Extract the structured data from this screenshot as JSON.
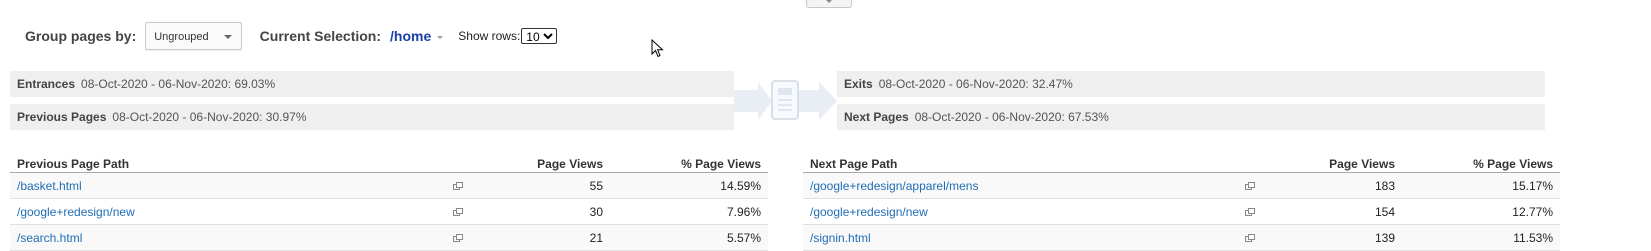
{
  "controls": {
    "group_label": "Group pages by:",
    "group_value": "Ungrouped",
    "current_label": "Current Selection:",
    "current_value": "/home",
    "rows_label": "Show rows:",
    "rows_value": "10"
  },
  "summary": {
    "entrances": {
      "label": "Entrances",
      "text": "08-Oct-2020 - 06-Nov-2020: 69.03%"
    },
    "previous": {
      "label": "Previous Pages",
      "text": "08-Oct-2020 - 06-Nov-2020: 30.97%"
    },
    "exits": {
      "label": "Exits",
      "text": "08-Oct-2020 - 06-Nov-2020: 32.47%"
    },
    "next": {
      "label": "Next Pages",
      "text": "08-Oct-2020 - 06-Nov-2020: 67.53%"
    }
  },
  "icons": {
    "flow": "page-flow-icon",
    "external": "open-external-icon"
  },
  "colors": {
    "link": "#1f6db5",
    "selection": "#1a3fa8",
    "bar_bg": "#efefef"
  },
  "prev_table": {
    "headers": [
      "Previous Page Path",
      "Page Views",
      "% Page Views"
    ],
    "rows": [
      {
        "path": "/basket.html",
        "views": "55",
        "pct": "14.59%"
      },
      {
        "path": "/google+redesign/new",
        "views": "30",
        "pct": "7.96%"
      },
      {
        "path": "/search.html",
        "views": "21",
        "pct": "5.57%"
      }
    ]
  },
  "next_table": {
    "headers": [
      "Next Page Path",
      "Page Views",
      "% Page Views"
    ],
    "rows": [
      {
        "path": "/google+redesign/apparel/mens",
        "views": "183",
        "pct": "15.17%"
      },
      {
        "path": "/google+redesign/new",
        "views": "154",
        "pct": "12.77%"
      },
      {
        "path": "/signin.html",
        "views": "139",
        "pct": "11.53%"
      }
    ]
  }
}
